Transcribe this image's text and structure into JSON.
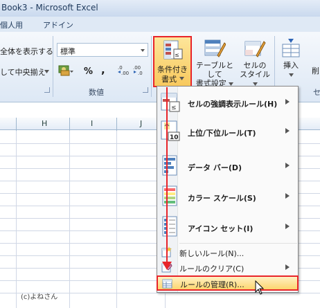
{
  "window": {
    "title": "Book3  -  Microsoft Excel"
  },
  "tabs": [
    {
      "label": "個人用"
    },
    {
      "label": "アドイン"
    }
  ],
  "ribbon": {
    "wrap_text": "全体を表示する",
    "merge_center": "して中央揃え",
    "number_format_value": "標準",
    "percent_symbol": "%",
    "comma_symbol": ",",
    "number_group_label": "数値",
    "conditional_formatting_line1": "条件付き",
    "conditional_formatting_line2": "書式",
    "format_as_table_line1": "テーブルとして",
    "format_as_table_line2": "書式設定",
    "cell_styles_line1": "セルの",
    "cell_styles_line2": "スタイル",
    "insert_label": "挿入",
    "delete_label": "削",
    "cells_group_label": "セ"
  },
  "columns": [
    "H",
    "I",
    "J"
  ],
  "credit": "(c)よねさん",
  "menu": {
    "items": [
      {
        "label": "セルの強調表示ルール(H)",
        "has_submenu": true,
        "icon": "highlight-rules-icon"
      },
      {
        "label": "上位/下位ルール(T)",
        "has_submenu": true,
        "icon": "top-bottom-rules-icon",
        "icon_text": "10"
      },
      {
        "label": "データ バー(D)",
        "has_submenu": true,
        "icon": "data-bars-icon"
      },
      {
        "label": "カラー スケール(S)",
        "has_submenu": true,
        "icon": "color-scales-icon"
      },
      {
        "label": "アイコン セット(I)",
        "has_submenu": true,
        "icon": "icon-sets-icon"
      }
    ],
    "small_items": [
      {
        "label": "新しいルール(N)...",
        "has_submenu": false,
        "icon": "new-rule-icon"
      },
      {
        "label": "ルールのクリア(C)",
        "has_submenu": true,
        "icon": "clear-rules-icon"
      },
      {
        "label": "ルールの管理(R)...",
        "has_submenu": false,
        "icon": "manage-rules-icon",
        "highlighted": true
      }
    ]
  },
  "colors": {
    "accent_red": "#e8242a",
    "highlight": "#fcd56f",
    "ribbon_bg": "#dde8f5"
  }
}
